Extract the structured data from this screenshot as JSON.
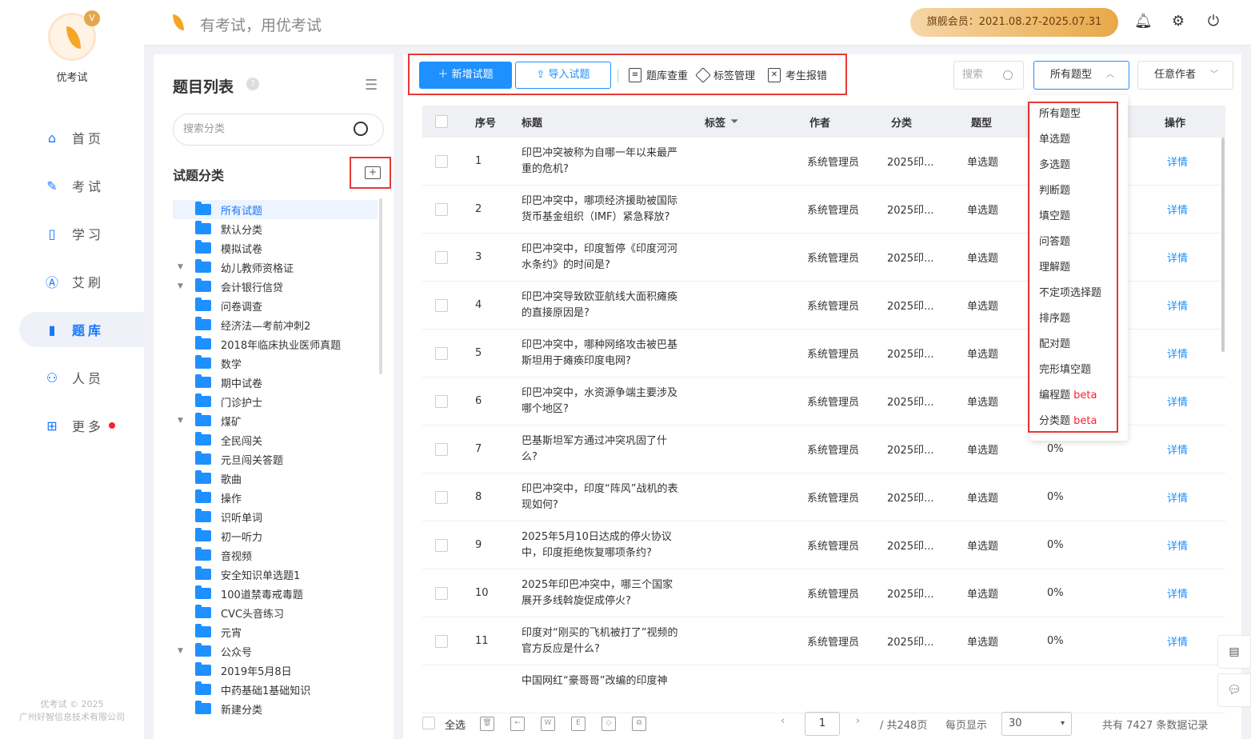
{
  "app": {
    "name": "优考试",
    "slogan": "有考试，用优考试",
    "membership": "旗舰会员：2021.08.27-2025.07.31",
    "crown_glyph": "V"
  },
  "nav": [
    {
      "label": "首页",
      "icon": "home-icon"
    },
    {
      "label": "考试",
      "icon": "exam-icon"
    },
    {
      "label": "学习",
      "icon": "book-icon"
    },
    {
      "label": "艾刷",
      "icon": "a-icon"
    },
    {
      "label": "题库",
      "icon": "chart-bars-icon",
      "active": true
    },
    {
      "label": "人员",
      "icon": "user-icon"
    },
    {
      "label": "更多",
      "icon": "apps-icon",
      "badge": true
    }
  ],
  "copyright": {
    "line1": "优考试 © 2025",
    "line2": "广州好智信息技术有限公司"
  },
  "left_panel": {
    "title": "题目列表",
    "search_placeholder": "搜索分类",
    "section_title": "试题分类",
    "categories": [
      {
        "label": "所有试题",
        "selected": true,
        "expandable": false
      },
      {
        "label": "默认分类",
        "expandable": false
      },
      {
        "label": "模拟试卷",
        "expandable": false
      },
      {
        "label": "幼儿教师资格证",
        "expandable": true
      },
      {
        "label": "会计银行信贷",
        "expandable": true
      },
      {
        "label": "问卷调查",
        "expandable": false
      },
      {
        "label": "经济法—考前冲刺2",
        "expandable": false
      },
      {
        "label": "2018年临床执业医师真题",
        "expandable": false
      },
      {
        "label": "数学",
        "expandable": false
      },
      {
        "label": "期中试卷",
        "expandable": false
      },
      {
        "label": "门诊护士",
        "expandable": false
      },
      {
        "label": "煤矿",
        "expandable": true
      },
      {
        "label": "全民闯关",
        "expandable": false
      },
      {
        "label": "元旦闯关答题",
        "expandable": false
      },
      {
        "label": "歌曲",
        "expandable": false
      },
      {
        "label": "操作",
        "expandable": false
      },
      {
        "label": "识听单词",
        "expandable": false
      },
      {
        "label": "初一听力",
        "expandable": false
      },
      {
        "label": "音视频",
        "expandable": false
      },
      {
        "label": "安全知识单选题1",
        "expandable": false
      },
      {
        "label": "100道禁毒戒毒题",
        "expandable": false
      },
      {
        "label": "CVC头音练习",
        "expandable": false
      },
      {
        "label": "元宵",
        "expandable": false
      },
      {
        "label": "公众号",
        "expandable": true
      },
      {
        "label": "2019年5月8日",
        "expandable": false
      },
      {
        "label": "中药基础1基础知识",
        "expandable": false
      },
      {
        "label": "新建分类",
        "expandable": false
      }
    ]
  },
  "toolbar": {
    "add_label": "新增试题",
    "import_label": "导入试题",
    "dedupe_label": "题库查重",
    "tags_label": "标签管理",
    "errors_label": "考生报错",
    "search_placeholder": "搜索",
    "type_select": "所有题型",
    "author_select": "任意作者"
  },
  "table": {
    "headers": {
      "index": "序号",
      "title": "标题",
      "tags": "标签",
      "author": "作者",
      "category": "分类",
      "type": "题型",
      "action": "操作"
    },
    "rows": [
      {
        "index": "1",
        "title": "印巴冲突被称为自哪一年以来最严重的危机?",
        "author": "系统管理员",
        "category": "2025印...",
        "type": "单选题",
        "rate": "",
        "action": "详情"
      },
      {
        "index": "2",
        "title": "印巴冲突中，哪项经济援助被国际货币基金组织（IMF）紧急释放?",
        "author": "系统管理员",
        "category": "2025印...",
        "type": "单选题",
        "rate": "",
        "action": "详情"
      },
      {
        "index": "3",
        "title": "印巴冲突中，印度暂停《印度河河水条约》的时间是?",
        "author": "系统管理员",
        "category": "2025印...",
        "type": "单选题",
        "rate": "",
        "action": "详情"
      },
      {
        "index": "4",
        "title": "印巴冲突导致欧亚航线大面积瘫痪的直接原因是?",
        "author": "系统管理员",
        "category": "2025印...",
        "type": "单选题",
        "rate": "",
        "action": "详情"
      },
      {
        "index": "5",
        "title": "印巴冲突中，哪种网络攻击被巴基斯坦用于瘫痪印度电网?",
        "author": "系统管理员",
        "category": "2025印...",
        "type": "单选题",
        "rate": "",
        "action": "详情"
      },
      {
        "index": "6",
        "title": "印巴冲突中，水资源争端主要涉及哪个地区?",
        "author": "系统管理员",
        "category": "2025印...",
        "type": "单选题",
        "rate": "",
        "action": "详情"
      },
      {
        "index": "7",
        "title": "巴基斯坦军方通过冲突巩固了什么?",
        "author": "系统管理员",
        "category": "2025印...",
        "type": "单选题",
        "rate": "0%",
        "action": "详情"
      },
      {
        "index": "8",
        "title": "印巴冲突中，印度“阵风”战机的表现如何?",
        "author": "系统管理员",
        "category": "2025印...",
        "type": "单选题",
        "rate": "0%",
        "action": "详情"
      },
      {
        "index": "9",
        "title": "2025年5月10日达成的停火协议中，印度拒绝恢复哪项条约?",
        "author": "系统管理员",
        "category": "2025印...",
        "type": "单选题",
        "rate": "0%",
        "action": "详情"
      },
      {
        "index": "10",
        "title": "2025年印巴冲突中，哪三个国家展开多线斡旋促成停火?",
        "author": "系统管理员",
        "category": "2025印...",
        "type": "单选题",
        "rate": "0%",
        "action": "详情"
      },
      {
        "index": "11",
        "title": "印度对“刚买的飞机被打了”视频的官方反应是什么?",
        "author": "系统管理员",
        "category": "2025印...",
        "type": "单选题",
        "rate": "0%",
        "action": "详情"
      },
      {
        "index": "",
        "title": "中国网红“豪哥哥”改编的印度神",
        "author": "",
        "category": "",
        "type": "",
        "rate": "",
        "action": ""
      }
    ]
  },
  "type_dropdown": [
    {
      "label": "所有题型",
      "beta": ""
    },
    {
      "label": "单选题",
      "beta": ""
    },
    {
      "label": "多选题",
      "beta": ""
    },
    {
      "label": "判断题",
      "beta": ""
    },
    {
      "label": "填空题",
      "beta": ""
    },
    {
      "label": "问答题",
      "beta": ""
    },
    {
      "label": "理解题",
      "beta": ""
    },
    {
      "label": "不定项选择题",
      "beta": ""
    },
    {
      "label": "排序题",
      "beta": ""
    },
    {
      "label": "配对题",
      "beta": ""
    },
    {
      "label": "完形填空题",
      "beta": ""
    },
    {
      "label": "编程题 ",
      "beta": "beta"
    },
    {
      "label": "分类题 ",
      "beta": "beta"
    }
  ],
  "footer": {
    "select_all": "全选",
    "page": "1",
    "total_pages": "/ 共248页",
    "per_page_label": "每页显示",
    "per_page": "30",
    "total_records": "共有 7427 条数据记录"
  }
}
